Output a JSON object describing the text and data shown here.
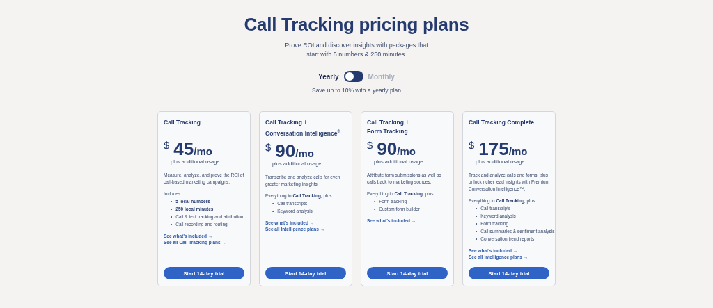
{
  "header": {
    "title": "Call Tracking pricing plans",
    "subtitle": "Prove ROI and discover insights with packages that start with 5 numbers & 250 minutes."
  },
  "billing": {
    "options": [
      {
        "label": "Yearly",
        "selected": true
      },
      {
        "label": "Monthly",
        "selected": false
      }
    ],
    "note": "Save up to 10% with a yearly plan"
  },
  "plans": [
    {
      "name": [
        "Call Tracking"
      ],
      "currency": "$",
      "price": "45",
      "period": "/mo",
      "usage": "plus additional usage",
      "description": "Measure, analyze, and prove the ROI of call-based marketing campaigns.",
      "features_intro": "Includes:",
      "features": [
        {
          "marker": "•",
          "text": "5 local numbers",
          "bold": true
        },
        {
          "marker": "•",
          "text": "250 local minutes",
          "bold": true
        },
        {
          "marker": "•",
          "text": "Call & text tracking and attribution",
          "bold": false
        },
        {
          "marker": "•",
          "text": "Call recording and routing",
          "bold": false
        }
      ],
      "links": [
        "See what’s included →",
        "See all Call Tracking plans →"
      ],
      "button": "Start 14-day trial"
    },
    {
      "name": [
        "Call Tracking +",
        "Conversation Intelligence$^{®}$"
      ],
      "currency": "$",
      "price": "90",
      "period": "/mo",
      "usage": "plus additional usage",
      "description": "Transcribe and analyze calls for even greater marketing insights.",
      "features_intro": "Everything in **Call Tracking**, plus:",
      "features": [
        {
          "marker": "•",
          "text": "Call transcripts",
          "bold": false
        },
        {
          "marker": "•",
          "text": "Keyword analysis",
          "bold": false
        }
      ],
      "links": [
        "See what’s included →",
        "See all Intelligence plans →"
      ],
      "button": "Start 14-day trial"
    },
    {
      "name": [
        "Call Tracking +",
        "Form Tracking"
      ],
      "currency": "$",
      "price": "90",
      "period": "/mo",
      "usage": "plus additional usage",
      "description": "Attribute form submissions as well as calls back to marketing sources.",
      "features_intro": "Everything in **Call Tracking**, plus:",
      "features": [
        {
          "marker": "•",
          "text": "Form tracking",
          "bold": false
        },
        {
          "marker": "•",
          "text": "Custom form builder",
          "bold": false
        }
      ],
      "links": [
        "See what’s included →"
      ],
      "button": "Start 14-day trial"
    },
    {
      "name": [
        "Call Tracking Complete"
      ],
      "currency": "$",
      "price": "175",
      "period": "/mo",
      "usage": "plus additional usage",
      "description": "Track and analyze calls and forms, plus unlock richer lead insights with Premium Conversation Intelligence™.",
      "features_intro": "Everything in **Call Tracking**, plus:",
      "features": [
        {
          "marker": "•",
          "text": "Call transcripts",
          "bold": false
        },
        {
          "marker": "•",
          "text": "Keyword analysis",
          "bold": false
        },
        {
          "marker": "•",
          "text": "Form tracking",
          "bold": false
        },
        {
          "marker": "•",
          "text": "Call summaries & sentiment analysis",
          "bold": false
        },
        {
          "marker": "•",
          "text": "Conversation trend reports",
          "bold": false
        }
      ],
      "links": [
        "See what’s included →",
        "See all Intelligence plans →"
      ],
      "button": "Start 14-day trial"
    }
  ]
}
